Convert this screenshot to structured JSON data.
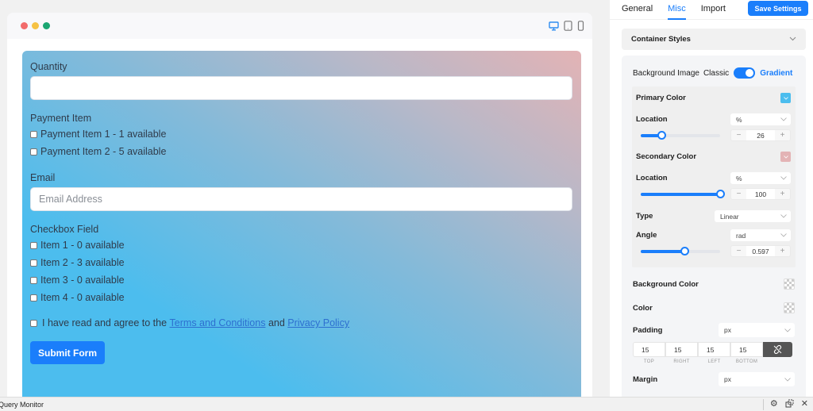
{
  "preview": {
    "window_dots": [
      {
        "name": "close",
        "color": "#f26b6b"
      },
      {
        "name": "minimize",
        "color": "#f6c244"
      },
      {
        "name": "maximize",
        "color": "#1ba672"
      }
    ],
    "devices": [
      {
        "name": "desktop",
        "active": true
      },
      {
        "name": "tablet",
        "active": false
      },
      {
        "name": "mobile",
        "active": false
      }
    ],
    "form": {
      "quantity": {
        "label": "Quantity",
        "value": "",
        "placeholder": ""
      },
      "payment_item": {
        "label": "Payment Item",
        "options": [
          "Payment Item 1 - 1 available",
          "Payment Item 2 - 5 available"
        ]
      },
      "email": {
        "label": "Email",
        "value": "",
        "placeholder": "Email Address"
      },
      "checkbox_field": {
        "label": "Checkbox Field",
        "options": [
          "Item 1 - 0 available",
          "Item 2 - 3 available",
          "Item 3 - 0 available",
          "Item 4 - 0 available"
        ]
      },
      "terms": {
        "prefix": "I have read and agree to the",
        "terms_link": "Terms and Conditions",
        "and": "and",
        "privacy_link": "Privacy Policy"
      },
      "submit_label": "Submit Form"
    }
  },
  "settings": {
    "tabs": [
      {
        "label": "General",
        "active": false
      },
      {
        "label": "Misc",
        "active": true
      },
      {
        "label": "Import",
        "active": false
      }
    ],
    "save_label": "Save Settings",
    "section_title": "Container Styles",
    "background_image": {
      "label": "Background Image",
      "option_off": "Classic",
      "option_on": "Gradient",
      "gradient_enabled": true
    },
    "primary": {
      "label": "Primary Color",
      "color": "#4cbdee",
      "location_label": "Location",
      "unit": "%",
      "value": "26",
      "slider_percent": 26
    },
    "secondary": {
      "label": "Secondary Color",
      "color": "#e3b3b5",
      "location_label": "Location",
      "unit": "%",
      "value": "100",
      "slider_percent": 100
    },
    "type": {
      "label": "Type",
      "value": "Linear"
    },
    "angle": {
      "label": "Angle",
      "unit": "rad",
      "value": "0.597",
      "slider_percent": 55
    },
    "background_color": {
      "label": "Background Color"
    },
    "color": {
      "label": "Color"
    },
    "padding": {
      "label": "Padding",
      "unit": "px",
      "values": [
        "15",
        "15",
        "15",
        "15"
      ],
      "sides": [
        "TOP",
        "RIGHT",
        "LEFT",
        "BOTTOM"
      ]
    },
    "margin": {
      "label": "Margin",
      "unit": "px"
    }
  },
  "bottom_bar": {
    "title": "Query Monitor"
  },
  "colors": {
    "accent": "#1a7efb"
  }
}
